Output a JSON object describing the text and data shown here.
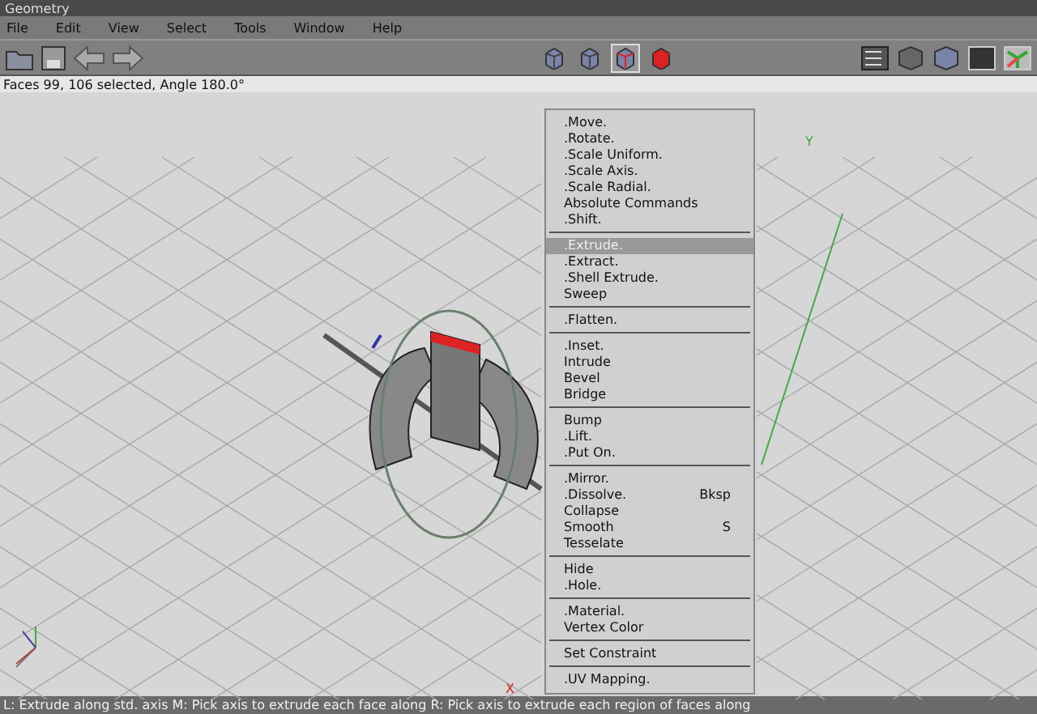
{
  "window": {
    "title": "Geometry"
  },
  "menubar": [
    "File",
    "Edit",
    "View",
    "Select",
    "Tools",
    "Window",
    "Help"
  ],
  "select_modes": [
    {
      "selected": false
    },
    {
      "selected": false
    },
    {
      "selected": true
    },
    {
      "selected": false
    }
  ],
  "info": "Faces 99, 106 selected, Angle 180.0°",
  "viewport": {
    "y_label": "Y",
    "x_label": "X"
  },
  "context_menu": [
    [
      {
        "label": ".Move.",
        "selected": false
      },
      {
        "label": ".Rotate.",
        "selected": false
      },
      {
        "label": ".Scale Uniform.",
        "selected": false
      },
      {
        "label": ".Scale Axis.",
        "selected": false
      },
      {
        "label": ".Scale Radial.",
        "selected": false
      },
      {
        "label": "Absolute Commands",
        "selected": false
      },
      {
        "label": ".Shift.",
        "selected": false
      }
    ],
    [
      {
        "label": ".Extrude.",
        "selected": true
      },
      {
        "label": ".Extract.",
        "selected": false
      },
      {
        "label": ".Shell Extrude.",
        "selected": false
      },
      {
        "label": "Sweep",
        "selected": false
      }
    ],
    [
      {
        "label": ".Flatten.",
        "selected": false
      }
    ],
    [
      {
        "label": ".Inset.",
        "selected": false
      },
      {
        "label": "Intrude",
        "selected": false
      },
      {
        "label": "Bevel",
        "selected": false
      },
      {
        "label": "Bridge",
        "selected": false
      }
    ],
    [
      {
        "label": "Bump",
        "selected": false
      },
      {
        "label": ".Lift.",
        "selected": false
      },
      {
        "label": ".Put On.",
        "selected": false
      }
    ],
    [
      {
        "label": ".Mirror.",
        "selected": false
      },
      {
        "label": ".Dissolve.",
        "shortcut": "Bksp",
        "selected": false
      },
      {
        "label": "Collapse",
        "selected": false
      },
      {
        "label": "Smooth",
        "shortcut": "S",
        "selected": false
      },
      {
        "label": "Tesselate",
        "selected": false
      }
    ],
    [
      {
        "label": "Hide",
        "selected": false
      },
      {
        "label": ".Hole.",
        "selected": false
      }
    ],
    [
      {
        "label": ".Material.",
        "selected": false
      },
      {
        "label": "Vertex Color",
        "selected": false
      }
    ],
    [
      {
        "label": "Set Constraint",
        "selected": false
      }
    ],
    [
      {
        "label": ".UV Mapping.",
        "selected": false
      }
    ]
  ],
  "status_bar": "L: Extrude along std. axis  M: Pick axis to extrude each face along  R: Pick axis to extrude each region of faces along"
}
